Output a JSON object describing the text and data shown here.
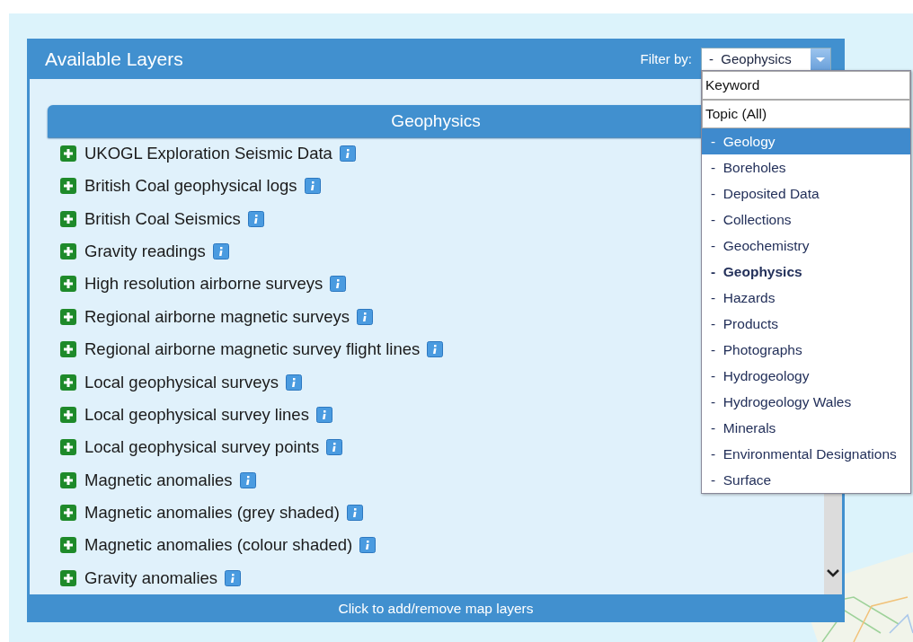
{
  "panel": {
    "title": "Available Layers",
    "filter_label": "Filter by:",
    "filter_value": "-  Geophysics",
    "footer": "Click to add/remove map layers"
  },
  "group": {
    "title": "Geophysics"
  },
  "layers": [
    {
      "name": "UKOGL Exploration Seismic Data"
    },
    {
      "name": "British Coal geophysical logs"
    },
    {
      "name": "British Coal Seismics"
    },
    {
      "name": "Gravity readings"
    },
    {
      "name": "High resolution airborne surveys"
    },
    {
      "name": "Regional airborne magnetic surveys"
    },
    {
      "name": "Regional airborne magnetic survey flight lines"
    },
    {
      "name": "Local geophysical surveys"
    },
    {
      "name": "Local geophysical survey lines"
    },
    {
      "name": "Local geophysical survey points"
    },
    {
      "name": "Magnetic anomalies"
    },
    {
      "name": "Magnetic anomalies (grey shaded)"
    },
    {
      "name": "Magnetic anomalies (colour shaded)"
    },
    {
      "name": "Gravity anomalies"
    }
  ],
  "dropdown": {
    "headers": [
      "Keyword",
      "Topic (All)"
    ],
    "options": [
      {
        "label": "-  Geology",
        "selected": false,
        "hovered": true
      },
      {
        "label": "-  Boreholes",
        "selected": false,
        "hovered": false
      },
      {
        "label": "-  Deposited Data",
        "selected": false,
        "hovered": false
      },
      {
        "label": "-  Collections",
        "selected": false,
        "hovered": false
      },
      {
        "label": "-  Geochemistry",
        "selected": false,
        "hovered": false
      },
      {
        "label": "-  Geophysics",
        "selected": true,
        "hovered": false
      },
      {
        "label": "-  Hazards",
        "selected": false,
        "hovered": false
      },
      {
        "label": "-  Products",
        "selected": false,
        "hovered": false
      },
      {
        "label": "-  Photographs",
        "selected": false,
        "hovered": false
      },
      {
        "label": "-  Hydrogeology",
        "selected": false,
        "hovered": false
      },
      {
        "label": "-  Hydrogeology Wales",
        "selected": false,
        "hovered": false
      },
      {
        "label": "-  Minerals",
        "selected": false,
        "hovered": false
      },
      {
        "label": "-  Environmental Designations",
        "selected": false,
        "hovered": false
      },
      {
        "label": "-  Surface",
        "selected": false,
        "hovered": false
      }
    ]
  }
}
